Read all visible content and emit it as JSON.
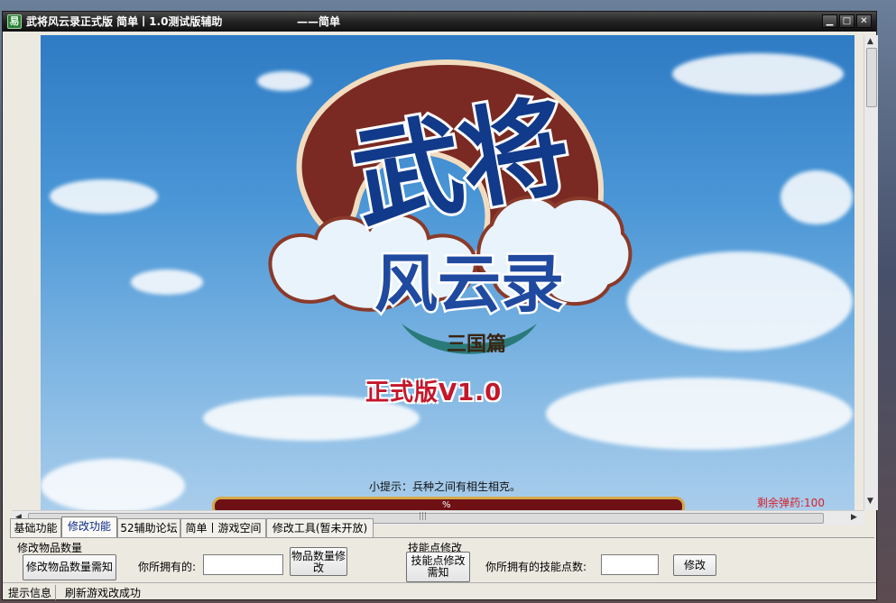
{
  "window": {
    "title": "武将风云录正式版 简单丨1.0测试版辅助",
    "title_suffix": "——简单",
    "app_icon": "易"
  },
  "game": {
    "logo_main": "武将",
    "logo_sub": "风云录",
    "logo_chapter": "三国篇",
    "version_text": "正式版V1.0",
    "hint_text": "小提示：兵种之间有相生相克。",
    "ammo_text": "剩余弹药:100",
    "bar_text": "%"
  },
  "tabs": [
    {
      "label": "基础功能"
    },
    {
      "label": "修改功能"
    },
    {
      "label": "52辅助论坛"
    },
    {
      "label": "简单丨游戏空间"
    },
    {
      "label": "修改工具(暂未开放)"
    }
  ],
  "active_tab_index": 1,
  "item_group": {
    "title": "修改物品数量",
    "notice_button": "修改物品数量需知",
    "owned_label": "你所拥有的:",
    "owned_value": "",
    "modify_button": "物品数量修改"
  },
  "skill_group": {
    "title": "技能点修改",
    "notice_button": "技能点修改需知",
    "owned_label": "你所拥有的技能点数:",
    "owned_value": "",
    "modify_button": "修改"
  },
  "status": {
    "label": "提示信息",
    "message": "刷新游戏改成功"
  },
  "colors": {
    "titlebar": "#1c1c1c",
    "ammo": "#d81f2a",
    "version": "#c4162a",
    "sky": "#4a96d6"
  }
}
